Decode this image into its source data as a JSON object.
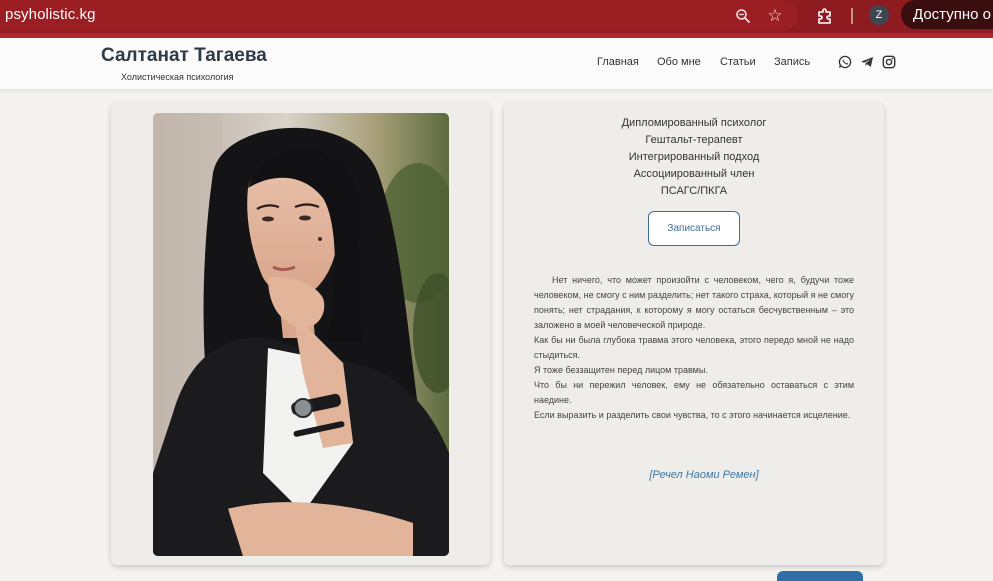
{
  "browser": {
    "url": "psyholistic.kg",
    "profile_initial": "Z",
    "available_label": "Доступно о",
    "icons": [
      "zoom-icon",
      "star-icon",
      "extensions-icon"
    ]
  },
  "header": {
    "brand_name": "Салтанат Тагаева",
    "brand_tagline": "Холистическая психология",
    "nav": {
      "home": "Главная",
      "about": "Обо мне",
      "articles": "Статьи",
      "booking": "Запись"
    },
    "social_icons": [
      "whatsapp-icon",
      "telegram-icon",
      "instagram-icon"
    ]
  },
  "info": {
    "credentials": [
      "Дипломированный психолог",
      "Гештальт-терапевт",
      "Интегрированный подход",
      "Ассоциированный член",
      "ПСАГС/ПКГА"
    ],
    "book_button": "Записаться",
    "quote": [
      "Нет ничего, что может произойти с человеком, чего я, будучи тоже человеком, не смогу с ним разделить; нет такого страха, который я не смогу понять; нет страдания, к которому я могу остаться бесчувственным – это заложено в моей человеческой природе.",
      "Как бы ни была глубока травма этого человека, этого передо мной не надо стыдиться.",
      "Я тоже беззащитен перед лицом травмы.",
      "Что бы ни пережил человек, ему не обязательно оставаться с этим наедине.",
      "Если выразить и разделить свои чувства, то с этого начинается исцеление."
    ],
    "author": "[Речел Наоми Ремен]"
  },
  "colors": {
    "browser_bar": "#8e1b1f",
    "accent_blue": "#3a6f95",
    "card_bg": "#eeedea"
  }
}
